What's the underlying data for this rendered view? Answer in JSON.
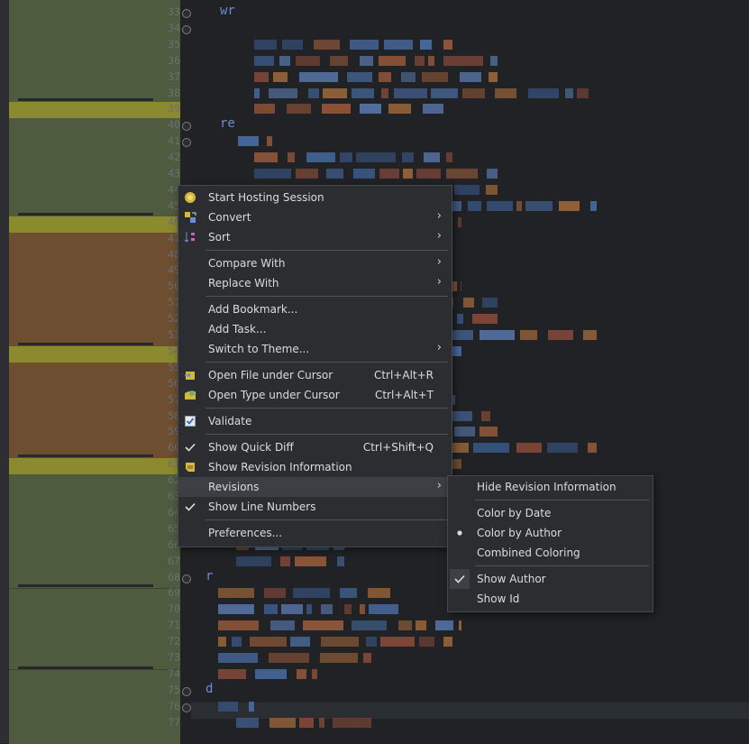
{
  "editor": {
    "line_numbers": [
      "33",
      "34",
      "35",
      "36",
      "37",
      "38",
      "39",
      "40",
      "41",
      "42",
      "43",
      "44",
      "45",
      "46",
      "47",
      "48",
      "49",
      "50",
      "51",
      "52",
      "53",
      "54",
      "55",
      "56",
      "57",
      "58",
      "59",
      "60",
      "61",
      "62",
      "63",
      "64",
      "65",
      "66",
      "67",
      "68",
      "69",
      "70",
      "71",
      "72",
      "73",
      "74",
      "75",
      "76",
      "77"
    ],
    "keywords": {
      "k33": "wr",
      "k40": "re",
      "k68": "r",
      "k75": "d"
    }
  },
  "context_menu": {
    "items": {
      "start_hosting": "Start Hosting Session",
      "convert": "Convert",
      "sort": "Sort",
      "compare_with": "Compare With",
      "replace_with": "Replace With",
      "add_bookmark": "Add Bookmark...",
      "add_task": "Add Task...",
      "switch_theme": "Switch to Theme...",
      "open_file": "Open File under Cursor",
      "open_type": "Open Type under Cursor",
      "validate": "Validate",
      "show_quick_diff": "Show Quick Diff",
      "show_revision_info": "Show Revision Information",
      "revisions": "Revisions",
      "show_line_numbers": "Show Line Numbers",
      "preferences": "Preferences..."
    },
    "shortcuts": {
      "open_file": "Ctrl+Alt+R",
      "open_type": "Ctrl+Alt+T",
      "show_quick_diff": "Ctrl+Shift+Q"
    },
    "arrow": "›"
  },
  "revisions_submenu": {
    "hide_revision_info": "Hide Revision Information",
    "color_by_date": "Color by Date",
    "color_by_author": "Color by Author",
    "combined_coloring": "Combined Coloring",
    "show_author": "Show Author",
    "show_id": "Show Id"
  },
  "colors": {
    "menu_bg": "#2b2d30",
    "highlight": "#3c3f43",
    "blame_green": "#4e5b3e",
    "blame_brown": "#6d4e30",
    "blame_yellow": "#8c8a2e"
  }
}
